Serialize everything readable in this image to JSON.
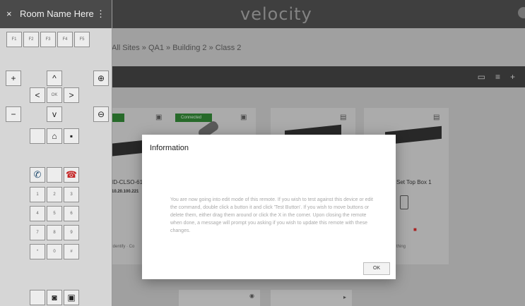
{
  "app": {
    "logo": "velocity"
  },
  "breadcrumb": "All Sites » QA1 » Building 2 » Class 2",
  "toolbar": {
    "icons": [
      "screen-icon",
      "sliders-icon",
      "plus-icon"
    ]
  },
  "cards": [
    {
      "status": "",
      "name": "ID-CLSO-61",
      "ip": "10.20.100.221",
      "footer": "Identify · Co"
    },
    {
      "status": "Connected"
    },
    {},
    {
      "name": "Set Top Box 1",
      "footer": "thing"
    }
  ],
  "dialog": {
    "title": "Information",
    "message": "You are now going into edit mode of this remote.  If you wish to test against this device or edit the command, double click a button it and click 'Test Button'.  If you wish to move buttons or delete them, either drag them around or click the X in the corner.  Upon closing the remote when done, a message will prompt you asking if you wish to update this remote with these changes.",
    "ok_label": "OK"
  },
  "remote": {
    "title": "Room Name Here",
    "close": "×",
    "menu": "⋮",
    "fkeys": [
      "F1",
      "F2",
      "F3",
      "F4",
      "F5"
    ],
    "vol_plus": "+",
    "vol_minus": "−",
    "up": "^",
    "down": "v",
    "left": "<",
    "right": ">",
    "ok": "OK",
    "keypad": [
      "1",
      "2",
      "3",
      "4",
      "5",
      "6",
      "7",
      "8",
      "9",
      "*",
      "0",
      "#"
    ]
  }
}
